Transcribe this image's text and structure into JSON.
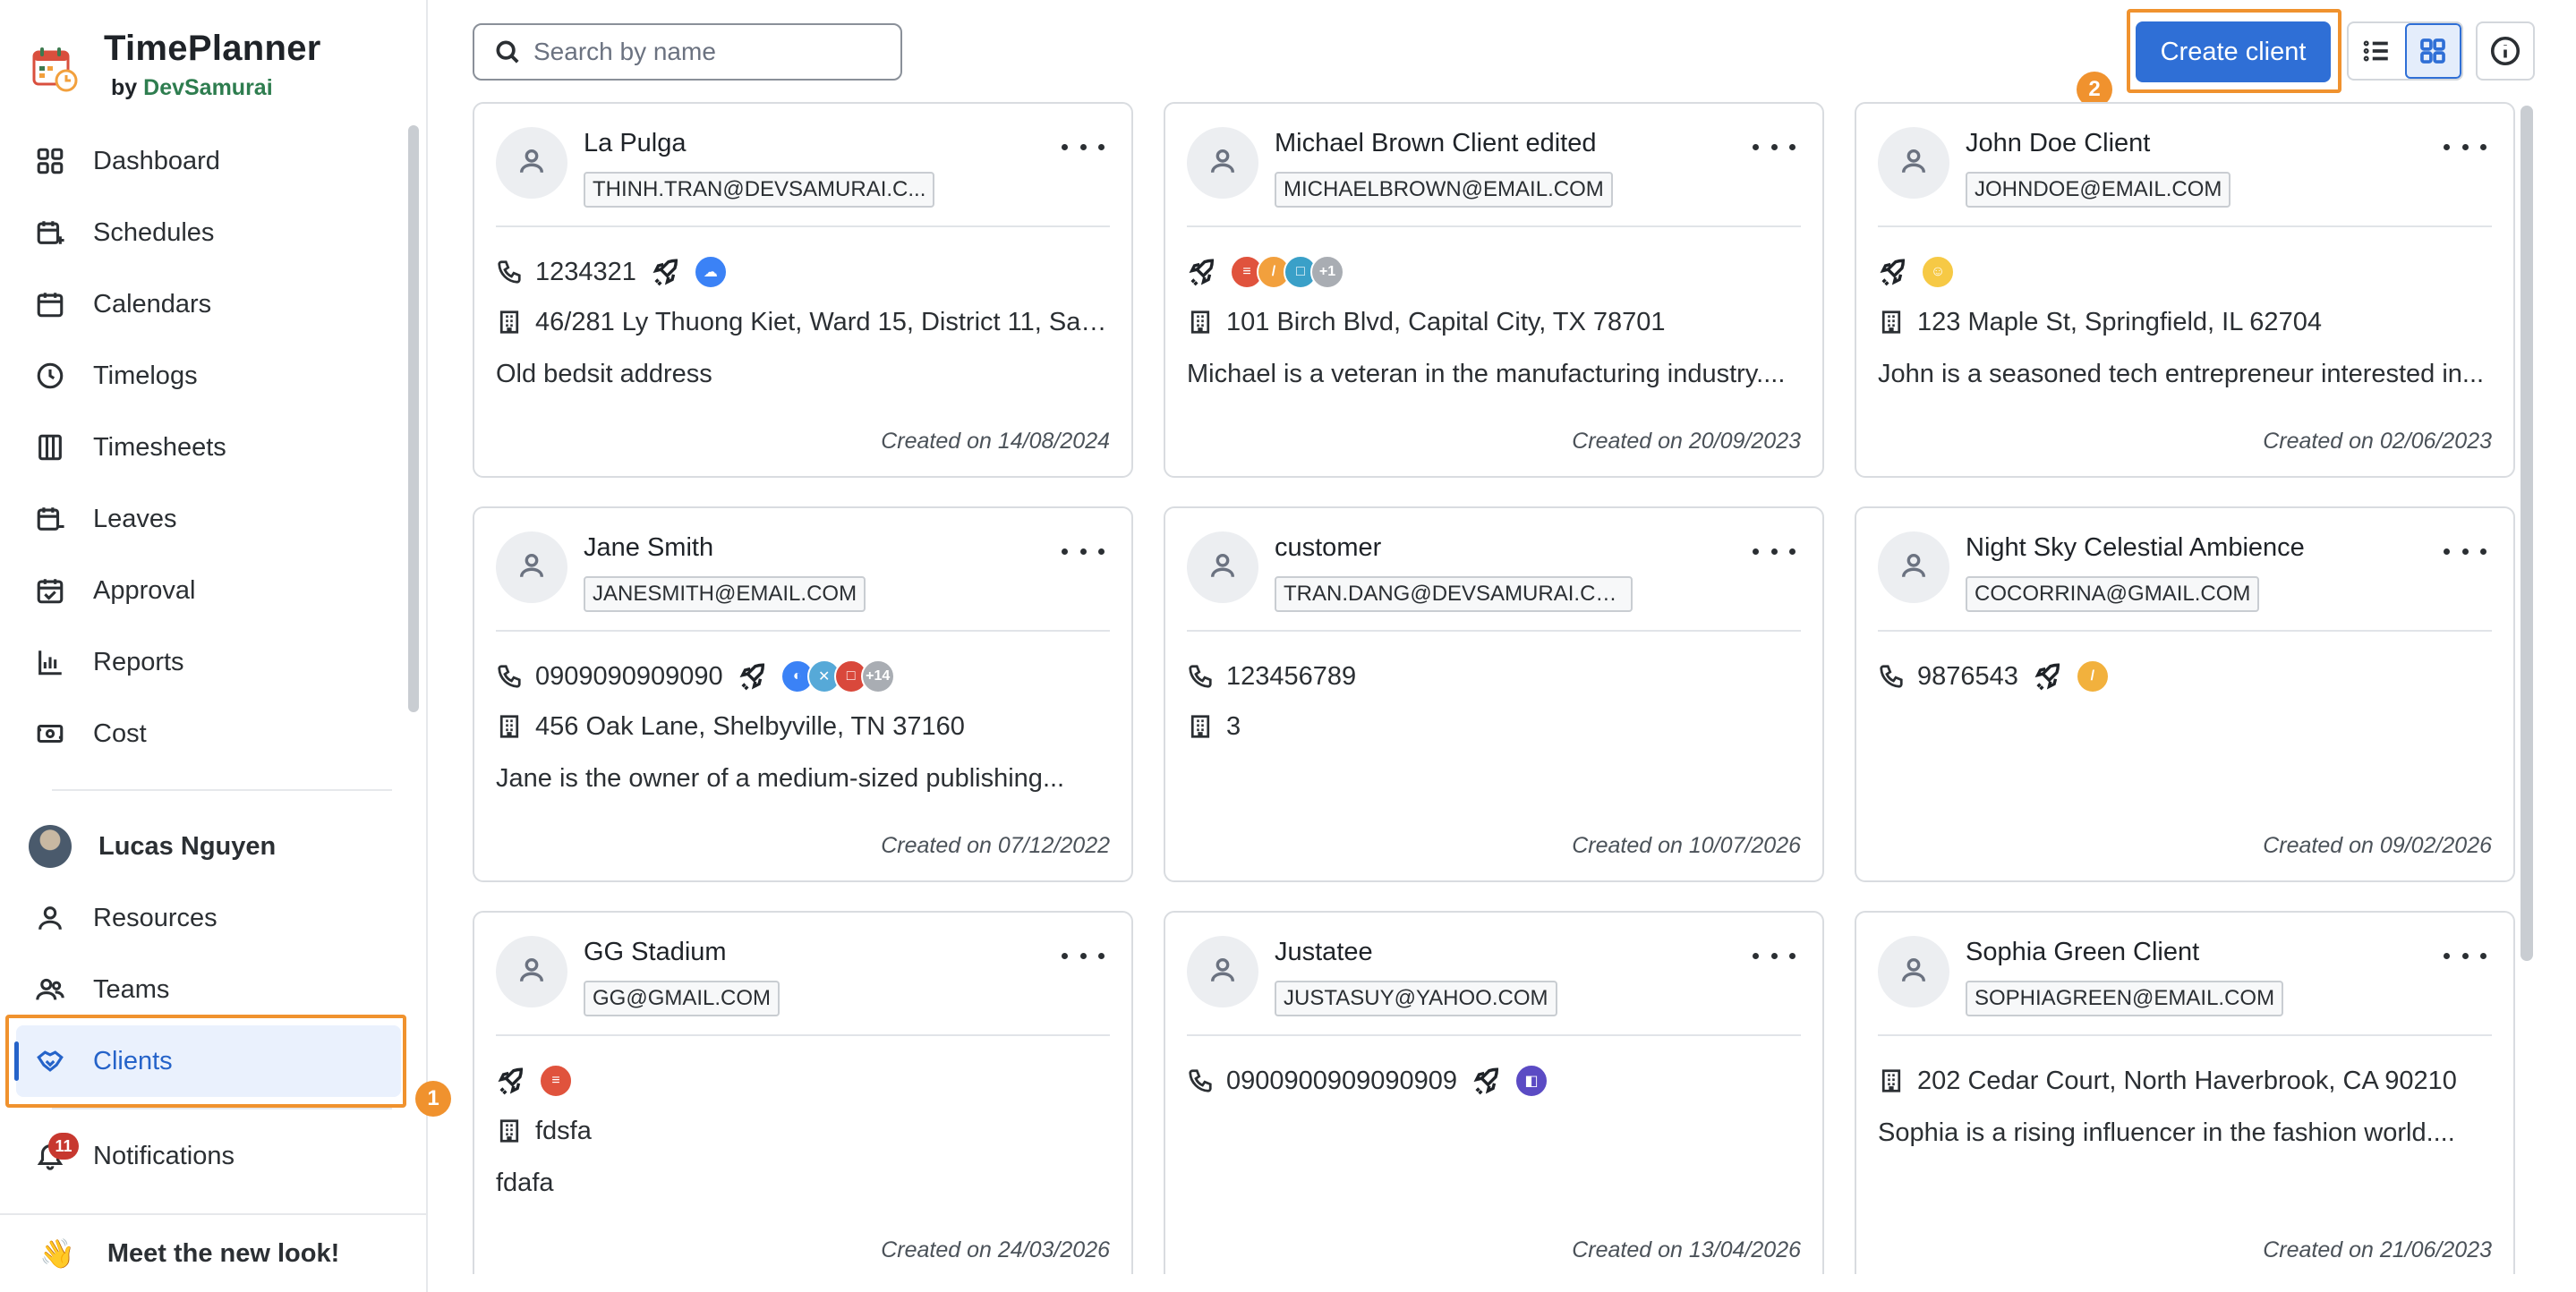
{
  "brand": {
    "title": "TimePlanner",
    "by": "by",
    "company": "DevSamurai"
  },
  "sidebar": {
    "items": [
      {
        "label": "Dashboard",
        "icon": "dashboard-icon"
      },
      {
        "label": "Schedules",
        "icon": "calendar-plus-icon"
      },
      {
        "label": "Calendars",
        "icon": "calendar-icon"
      },
      {
        "label": "Timelogs",
        "icon": "clock-icon"
      },
      {
        "label": "Timesheets",
        "icon": "columns-icon"
      },
      {
        "label": "Leaves",
        "icon": "calendar-minus-icon"
      },
      {
        "label": "Approval",
        "icon": "calendar-check-icon"
      },
      {
        "label": "Reports",
        "icon": "bar-chart-icon"
      },
      {
        "label": "Cost",
        "icon": "money-icon"
      }
    ],
    "user": {
      "name": "Lucas Nguyen"
    },
    "user_items": [
      {
        "label": "Resources",
        "icon": "person-icon"
      },
      {
        "label": "Teams",
        "icon": "people-icon"
      },
      {
        "label": "Clients",
        "icon": "handshake-icon",
        "active": true
      }
    ],
    "notifications": {
      "label": "Notifications",
      "count": "11"
    },
    "meet": {
      "label": "Meet the new look!",
      "emoji": "👋"
    }
  },
  "annotations": {
    "step1": "1",
    "step2": "2"
  },
  "toolbar": {
    "search_placeholder": "Search by name",
    "search_value": "",
    "create_label": "Create client",
    "view_mode": "grid"
  },
  "colors": {
    "accent": "#2f6fd6",
    "highlight": "#f0922e",
    "badge": "#c7382f"
  },
  "clients": [
    {
      "name": "La Pulga",
      "email": "THINH.TRAN@DEVSAMURAI.C...",
      "phone": "1234321",
      "apps": [
        {
          "c": "#3b82f6",
          "t": "☁"
        }
      ],
      "address": "46/281 Ly Thuong Kiet, Ward 15, District 11, Sai ...",
      "desc": "Old bedsit address",
      "created": "Created on 14/08/2024"
    },
    {
      "name": "Michael Brown Client edited",
      "email": "MICHAELBROWN@EMAIL.COM",
      "phone": "",
      "apps": [
        {
          "c": "#e0533d",
          "t": "≡"
        },
        {
          "c": "#f2a03d",
          "t": "/"
        },
        {
          "c": "#3aa0c8",
          "t": "□"
        },
        {
          "c": "#a9adb3",
          "t": "+1"
        }
      ],
      "address": "101 Birch Blvd, Capital City, TX 78701",
      "desc": "Michael is a veteran in the manufacturing industry....",
      "created": "Created on 20/09/2023"
    },
    {
      "name": "John Doe Client",
      "email": "JOHNDOE@EMAIL.COM",
      "phone": "",
      "apps": [
        {
          "c": "#f6c945",
          "t": "☺"
        }
      ],
      "address": "123 Maple St, Springfield, IL 62704",
      "desc": "John is a seasoned tech entrepreneur interested in...",
      "created": "Created on 02/06/2023"
    },
    {
      "name": "Jane Smith",
      "email": "JANESMITH@EMAIL.COM",
      "phone": "0909090909090",
      "apps": [
        {
          "c": "#3b82f6",
          "t": "◐"
        },
        {
          "c": "#56a9d8",
          "t": "✕"
        },
        {
          "c": "#d9483b",
          "t": "□"
        },
        {
          "c": "#a9adb3",
          "t": "+14"
        }
      ],
      "address": "456 Oak Lane, Shelbyville, TN 37160",
      "desc": "Jane is the owner of a medium-sized publishing...",
      "created": "Created on 07/12/2022"
    },
    {
      "name": "customer",
      "email": "TRAN.DANG@DEVSAMURAI.CO...",
      "phone": "123456789",
      "apps": [],
      "address": "3",
      "desc": "",
      "created": "Created on 10/07/2026",
      "no_rocket": true
    },
    {
      "name": "Night Sky Celestial Ambience",
      "email": "COCORRINA@GMAIL.COM",
      "phone": "9876543",
      "apps": [
        {
          "c": "#f2b13d",
          "t": "/"
        }
      ],
      "address": "",
      "desc": "",
      "created": "Created on 09/02/2026"
    },
    {
      "name": "GG Stadium",
      "email": "GG@GMAIL.COM",
      "phone": "",
      "apps": [
        {
          "c": "#e0533d",
          "t": "≡"
        }
      ],
      "address": "fdsfa",
      "desc": "fdafa",
      "created": "Created on 24/03/2026"
    },
    {
      "name": "Justatee",
      "email": "JUSTASUY@YAHOO.COM",
      "phone": "0900900909090909",
      "apps": [
        {
          "c": "#5b4bc4",
          "t": "◧"
        }
      ],
      "address": "",
      "desc": "",
      "created": "Created on 13/04/2026"
    },
    {
      "name": "Sophia Green Client",
      "email": "SOPHIAGREEN@EMAIL.COM",
      "phone": "",
      "apps": [],
      "address": "202 Cedar Court, North Haverbrook, CA 90210",
      "desc": "Sophia is a rising influencer in the fashion world....",
      "created": "Created on 21/06/2023",
      "no_rocket": true
    }
  ]
}
